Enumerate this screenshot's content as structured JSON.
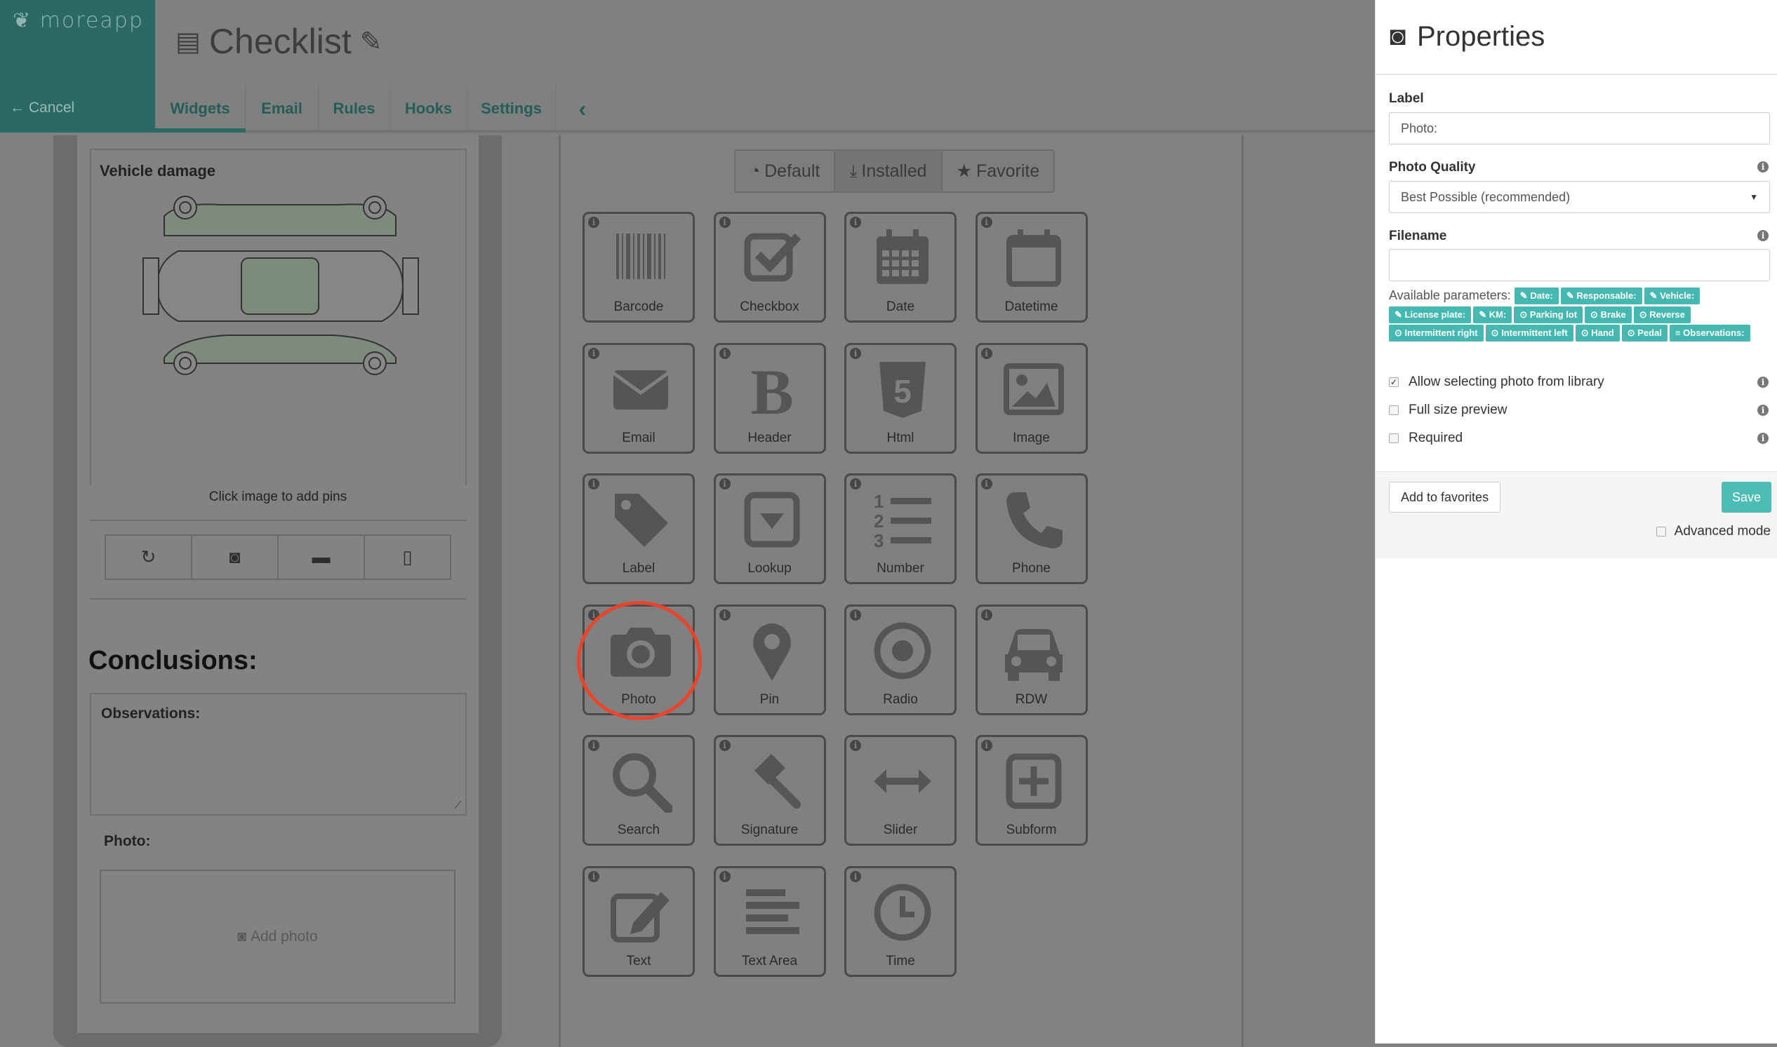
{
  "app": {
    "logo": "moreapp",
    "cancel": "Cancel",
    "title": "Checklist",
    "accent": "#2b6a64"
  },
  "tabs": [
    {
      "label": "Widgets",
      "active": true
    },
    {
      "label": "Email"
    },
    {
      "label": "Rules"
    },
    {
      "label": "Hooks"
    },
    {
      "label": "Settings"
    }
  ],
  "form": {
    "vehicle_damage": "Vehicle damage",
    "pin_hint": "Click image to add pins",
    "conclusions": "Conclusions:",
    "observations": "Observations:",
    "photo": "Photo:",
    "add_photo": "Add photo"
  },
  "filters": [
    {
      "label": "Default",
      "icon": "dashboard-icon"
    },
    {
      "label": "Installed",
      "icon": "download-icon",
      "active": true
    },
    {
      "label": "Favorite",
      "icon": "star-icon"
    }
  ],
  "widgets": [
    {
      "label": "Barcode",
      "icon": "barcode"
    },
    {
      "label": "Checkbox",
      "icon": "checkbox"
    },
    {
      "label": "Date",
      "icon": "date"
    },
    {
      "label": "Datetime",
      "icon": "datetime"
    },
    {
      "label": "Email",
      "icon": "email"
    },
    {
      "label": "Header",
      "icon": "header"
    },
    {
      "label": "Html",
      "icon": "html"
    },
    {
      "label": "Image",
      "icon": "image"
    },
    {
      "label": "Label",
      "icon": "label"
    },
    {
      "label": "Lookup",
      "icon": "lookup"
    },
    {
      "label": "Number",
      "icon": "number"
    },
    {
      "label": "Phone",
      "icon": "phone"
    },
    {
      "label": "Photo",
      "icon": "photo",
      "highlighted": true
    },
    {
      "label": "Pin",
      "icon": "pin"
    },
    {
      "label": "Radio",
      "icon": "radio"
    },
    {
      "label": "RDW",
      "icon": "car"
    },
    {
      "label": "Search",
      "icon": "search"
    },
    {
      "label": "Signature",
      "icon": "gavel"
    },
    {
      "label": "Slider",
      "icon": "slider"
    },
    {
      "label": "Subform",
      "icon": "subform"
    },
    {
      "label": "Text",
      "icon": "text"
    },
    {
      "label": "Text Area",
      "icon": "textarea"
    },
    {
      "label": "Time",
      "icon": "time"
    }
  ],
  "properties": {
    "title": "Properties",
    "label_label": "Label",
    "label_value": "Photo:",
    "quality_label": "Photo Quality",
    "quality_value": "Best Possible (recommended)",
    "filename_label": "Filename",
    "filename_value": "",
    "params_label": "Available parameters:",
    "params": [
      {
        "t": "Date:",
        "i": "✎"
      },
      {
        "t": "Responsable:",
        "i": "✎"
      },
      {
        "t": "Vehicle:",
        "i": "✎"
      },
      {
        "t": "License plate:",
        "i": "✎"
      },
      {
        "t": "KM:",
        "i": "✎"
      },
      {
        "t": "Parking lot",
        "i": "⊙"
      },
      {
        "t": "Brake",
        "i": "⊙"
      },
      {
        "t": "Reverse",
        "i": "⊙"
      },
      {
        "t": "Intermittent right",
        "i": "⊙"
      },
      {
        "t": "Intermittent left",
        "i": "⊙"
      },
      {
        "t": "Hand",
        "i": "⊙"
      },
      {
        "t": "Pedal",
        "i": "⊙"
      },
      {
        "t": "Observations:",
        "i": "≡"
      }
    ],
    "checks": [
      {
        "label": "Allow selecting photo from library",
        "checked": true
      },
      {
        "label": "Full size preview",
        "checked": false
      },
      {
        "label": "Required",
        "checked": false
      }
    ],
    "add_favorites": "Add to favorites",
    "save": "Save",
    "advanced": "Advanced mode"
  }
}
